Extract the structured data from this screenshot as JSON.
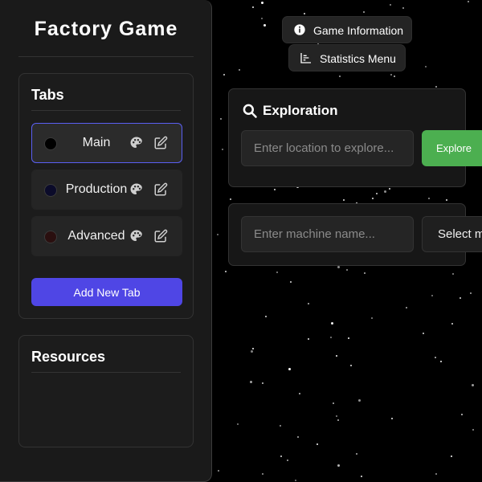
{
  "app": {
    "title": "Factory Game"
  },
  "sidebar": {
    "tabs_heading": "Tabs",
    "tabs": [
      {
        "label": "Main",
        "color": "#000000",
        "active": true
      },
      {
        "label": "Production",
        "color": "#0b0b2a",
        "active": false
      },
      {
        "label": "Advanced",
        "color": "#2a0f0f",
        "active": false
      }
    ],
    "add_tab_label": "Add New Tab",
    "resources_heading": "Resources"
  },
  "top_buttons": {
    "info_label": "Game Information",
    "stats_label": "Statistics Menu"
  },
  "exploration": {
    "heading": "Exploration",
    "input_placeholder": "Enter location to explore...",
    "explore_label": "Explore"
  },
  "machine": {
    "input_placeholder": "Enter machine name...",
    "select_label": "Select m"
  },
  "icons": {
    "info": "info-circle-icon",
    "stats": "bar-chart-icon",
    "search": "search-icon",
    "palette": "palette-icon",
    "edit": "edit-icon"
  },
  "colors": {
    "accent": "#4f46e5",
    "explore": "#4caf50",
    "active_border": "#5a5ff2"
  }
}
